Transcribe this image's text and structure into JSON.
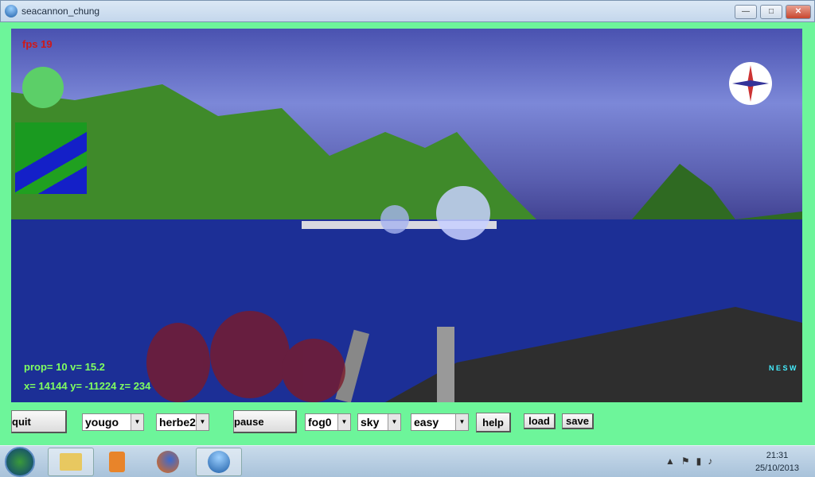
{
  "window": {
    "title": "seacannon_chung",
    "minimize": "—",
    "maximize": "□",
    "close": "✕"
  },
  "hud": {
    "fps": "fps 19",
    "prop_line": "prop= 10  v= 15.2",
    "pos_line": "x= 14144  y= -11224  z= 234",
    "compass_letters": "N E S W"
  },
  "controls": {
    "quit": "quit",
    "map_select": "yougo",
    "terrain_select": "herbe2",
    "pause": "pause",
    "fog_select": "fog0",
    "sky_select": "sky",
    "difficulty_select": "easy",
    "help": "help",
    "load": "load",
    "save": "save"
  },
  "taskbar": {
    "time": "21:31",
    "date": "25/10/2013",
    "icons": [
      "start-orb",
      "file-explorer-icon",
      "media-player-icon",
      "firefox-icon",
      "seacannon-app-icon"
    ]
  },
  "colors": {
    "frame": "#6df59a",
    "fps": "#d01818",
    "hud": "#80ff60"
  }
}
